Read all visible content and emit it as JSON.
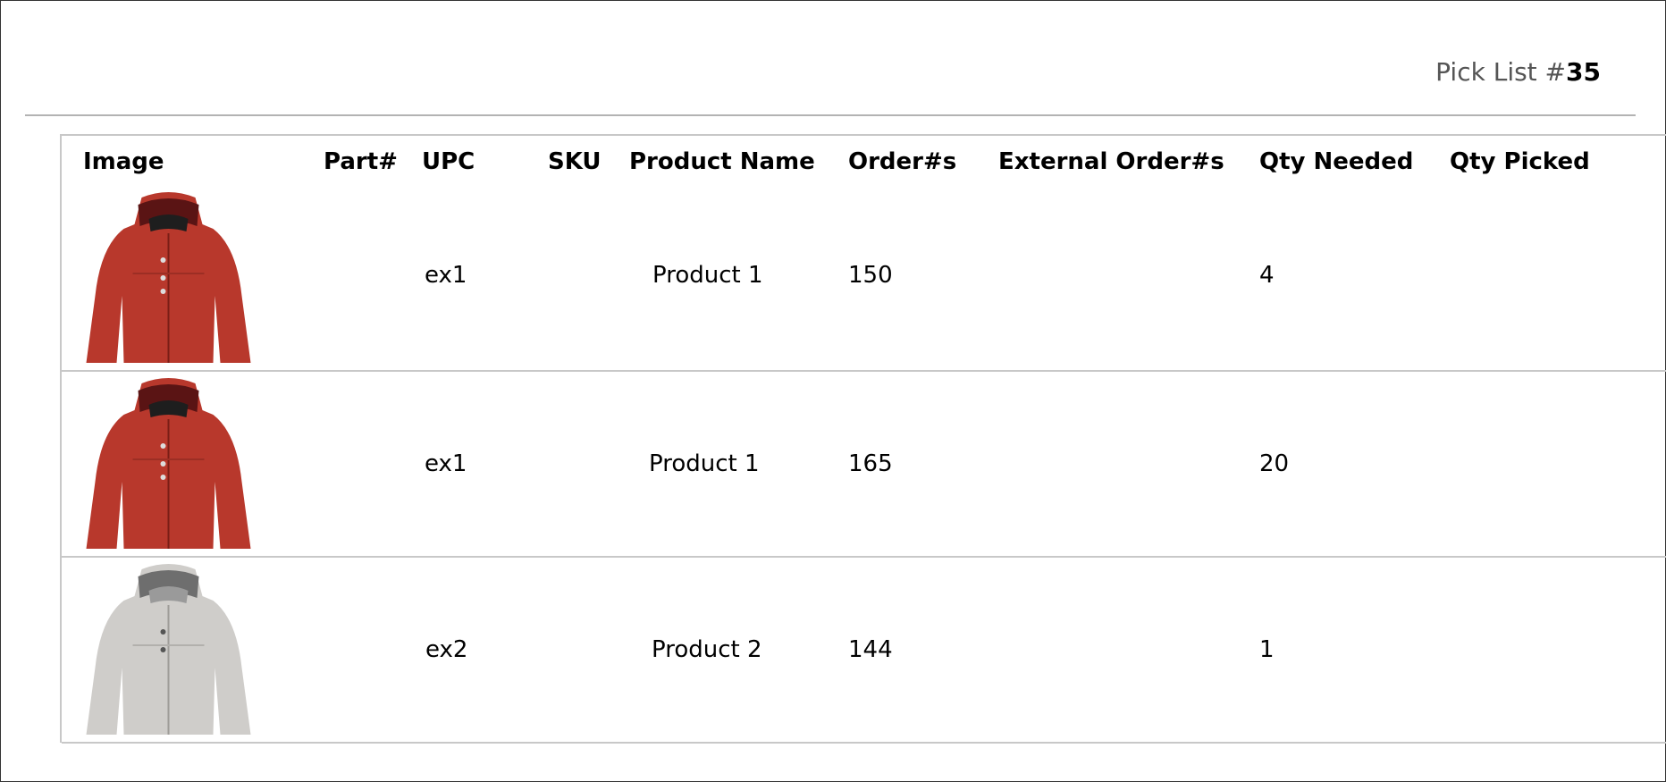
{
  "header": {
    "title_prefix": "Pick List #",
    "title_number": "35"
  },
  "columns": [
    "Image",
    "Part#",
    "UPC",
    "SKU",
    "Product Name",
    "Order#s",
    "External Order#s",
    "Qty Needed",
    "Qty Picked"
  ],
  "rows": [
    {
      "image_icon": "red-jacket-image",
      "part": "",
      "upc": "ex1",
      "sku": "",
      "product_name": "Product 1",
      "orders": "150",
      "external_orders": "",
      "qty_needed": "4",
      "qty_picked": ""
    },
    {
      "image_icon": "red-jacket-image",
      "part": "",
      "upc": "ex1",
      "sku": "",
      "product_name": "Product 1",
      "orders": "165",
      "external_orders": "",
      "qty_needed": "20",
      "qty_picked": ""
    },
    {
      "image_icon": "gray-jacket-image",
      "part": "",
      "upc": "ex2",
      "sku": "",
      "product_name": "Product 2",
      "orders": "144",
      "external_orders": "",
      "qty_needed": "1",
      "qty_picked": ""
    }
  ],
  "colors": {
    "jacket_red": "#b8382c",
    "jacket_gray": "#cfcdca",
    "divider": "#b3b3b3"
  }
}
